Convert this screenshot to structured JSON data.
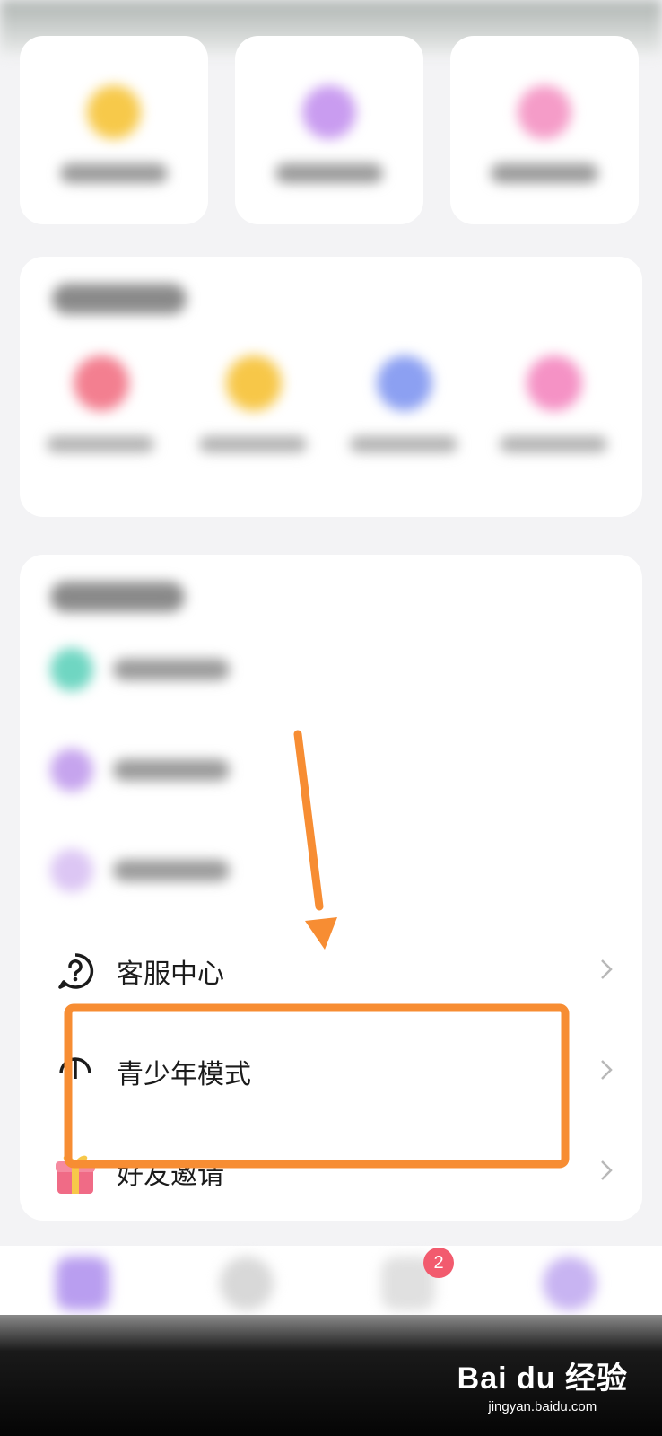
{
  "menu": {
    "items": [
      {
        "label": "客服中心",
        "icon": "question-circle-icon"
      },
      {
        "label": "青少年模式",
        "icon": "umbrella-icon"
      },
      {
        "label": "好友邀请",
        "icon": "gift-icon"
      }
    ]
  },
  "bottom_nav": {
    "badge_count": "2"
  },
  "watermark": {
    "brand": "Bai du 经验",
    "url": "jingyan.baidu.com"
  },
  "colors": {
    "annotation": "#f78d33",
    "badge": "#f25b6e"
  }
}
